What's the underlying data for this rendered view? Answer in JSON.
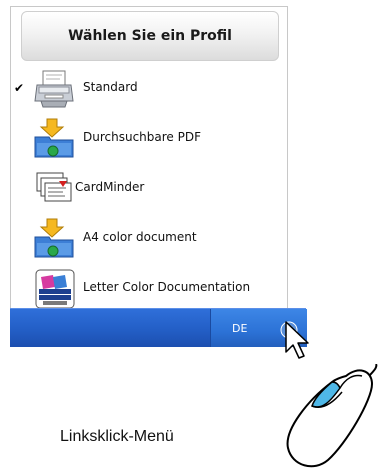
{
  "menu": {
    "header": "Wählen Sie ein Profil",
    "items": [
      {
        "label": "Standard",
        "icon": "printer-icon",
        "checked": true
      },
      {
        "label": "Durchsuchbare PDF",
        "icon": "scan-pdf-icon",
        "checked": false
      },
      {
        "label": "CardMinder",
        "icon": "cardminder-icon",
        "checked": false
      },
      {
        "label": "A4 color document",
        "icon": "scan-folder-icon",
        "checked": false
      },
      {
        "label": "Letter Color Documentation",
        "icon": "scansnap-organizer-icon",
        "checked": false
      }
    ],
    "check_glyph": "✔"
  },
  "taskbar": {
    "language": "DE",
    "tray_icon": "scansnap-manager-icon",
    "color": "#2460c8"
  },
  "caption": "Linksklick-Menü"
}
